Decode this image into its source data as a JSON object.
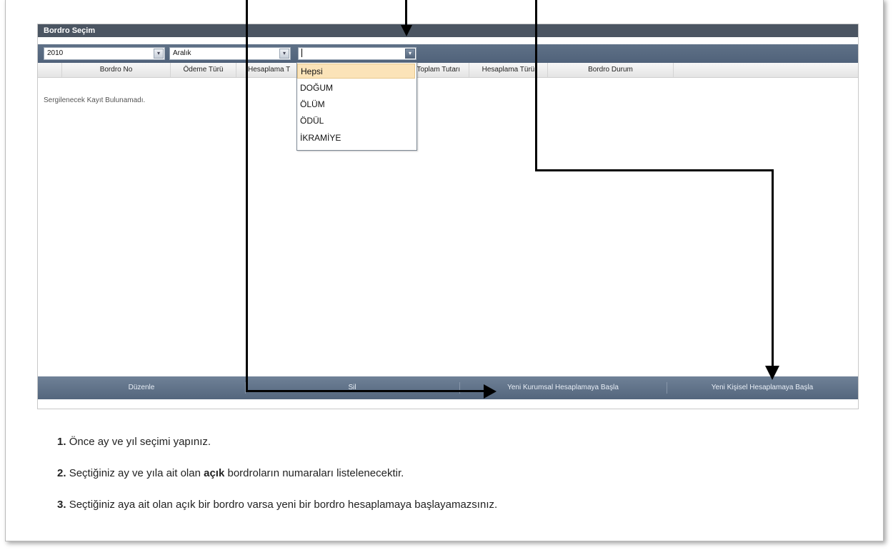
{
  "panel": {
    "title": "Bordro Seçim",
    "year": "2010",
    "month": "Aralık",
    "type_value": ""
  },
  "grid": {
    "columns": [
      "Bordro No",
      "Ödeme Türü",
      "Hesaplama T",
      "Toplam Tutarı",
      "Hesaplama Türü",
      "Bordro Durum"
    ],
    "empty_text": "Sergilenecek Kayıt Bulunamadı."
  },
  "dropdown": {
    "options": [
      "Hepsi",
      "DOĞUM",
      "ÖLÜM",
      "ÖDÜL",
      "İKRAMİYE"
    ],
    "selected": "Hepsi"
  },
  "footer": {
    "buttons": [
      "Düzenle",
      "Sil",
      "Yeni Kurumsal Hesaplamaya Başla",
      "Yeni Kişisel Hesaplamaya Başla"
    ]
  },
  "notes": [
    {
      "num": "1.",
      "pre": "Önce ay ve yıl seçimi yapınız.",
      "bold": "",
      "post": ""
    },
    {
      "num": "2.",
      "pre": "Seçtiğiniz ay ve yıla ait olan ",
      "bold": "açık",
      "post": " bordroların numaraları listelenecektir."
    },
    {
      "num": "3.",
      "pre": "Seçtiğiniz aya ait olan açık bir bordro varsa yeni bir bordro hesaplamaya başlayamazsınız.",
      "bold": "",
      "post": ""
    }
  ],
  "icons": {
    "combo_trigger": "chevron-down-icon",
    "annotation": "arrow-icon"
  },
  "colors": {
    "toolbar": "#5f7187",
    "header": "#4b5562",
    "selection": "#fbe3b8",
    "annotation": "#000000"
  }
}
